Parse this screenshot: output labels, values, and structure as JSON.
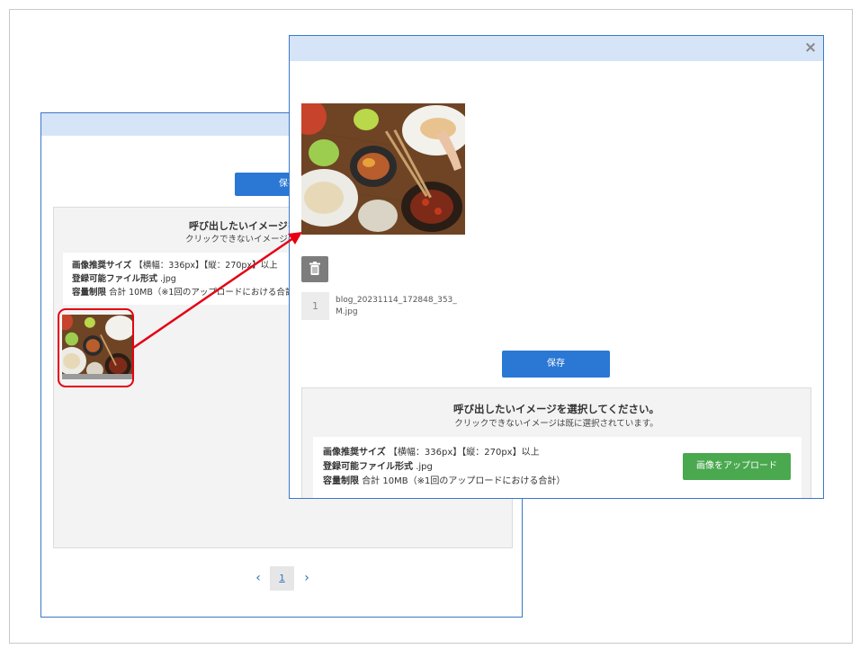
{
  "back_dialog": {
    "save_label": "保存",
    "panel_title": "呼び出したいイメージを",
    "panel_subtitle": "クリックできないイメージは",
    "info": {
      "size_label": "画像推奨サイズ",
      "size_value": "【横幅：336px】【縦：270px】以上",
      "format_label": "登録可能ファイル形式",
      "format_value": ".jpg",
      "limit_label": "容量制限",
      "limit_value": "合計 10MB（※1回のアップロードにおける合計）"
    },
    "pagination": {
      "prev": "‹",
      "current": "1",
      "next": "›"
    }
  },
  "front_dialog": {
    "close_label": "×",
    "file_index": "1",
    "file_name": "blog_20231114_172848_353_M.jpg",
    "save_label": "保存",
    "panel_title": "呼び出したいイメージを選択してください。",
    "panel_subtitle": "クリックできないイメージは既に選択されています。",
    "info": {
      "size_label": "画像推奨サイズ",
      "size_value": "【横幅：336px】【縦：270px】以上",
      "format_label": "登録可能ファイル形式",
      "format_value": ".jpg",
      "limit_label": "容量制限",
      "limit_value": "合計 10MB（※1回のアップロードにおける合計）"
    },
    "upload_label": "画像をアップロード"
  },
  "colors": {
    "titlebar": "#d6e4f7",
    "primary_button": "#2a77d4",
    "upload_button": "#4aa84f",
    "highlight": "#e60012"
  },
  "icons": [
    "close-icon",
    "trash-icon",
    "chevron-left-icon",
    "chevron-right-icon",
    "arrow-annotation"
  ]
}
